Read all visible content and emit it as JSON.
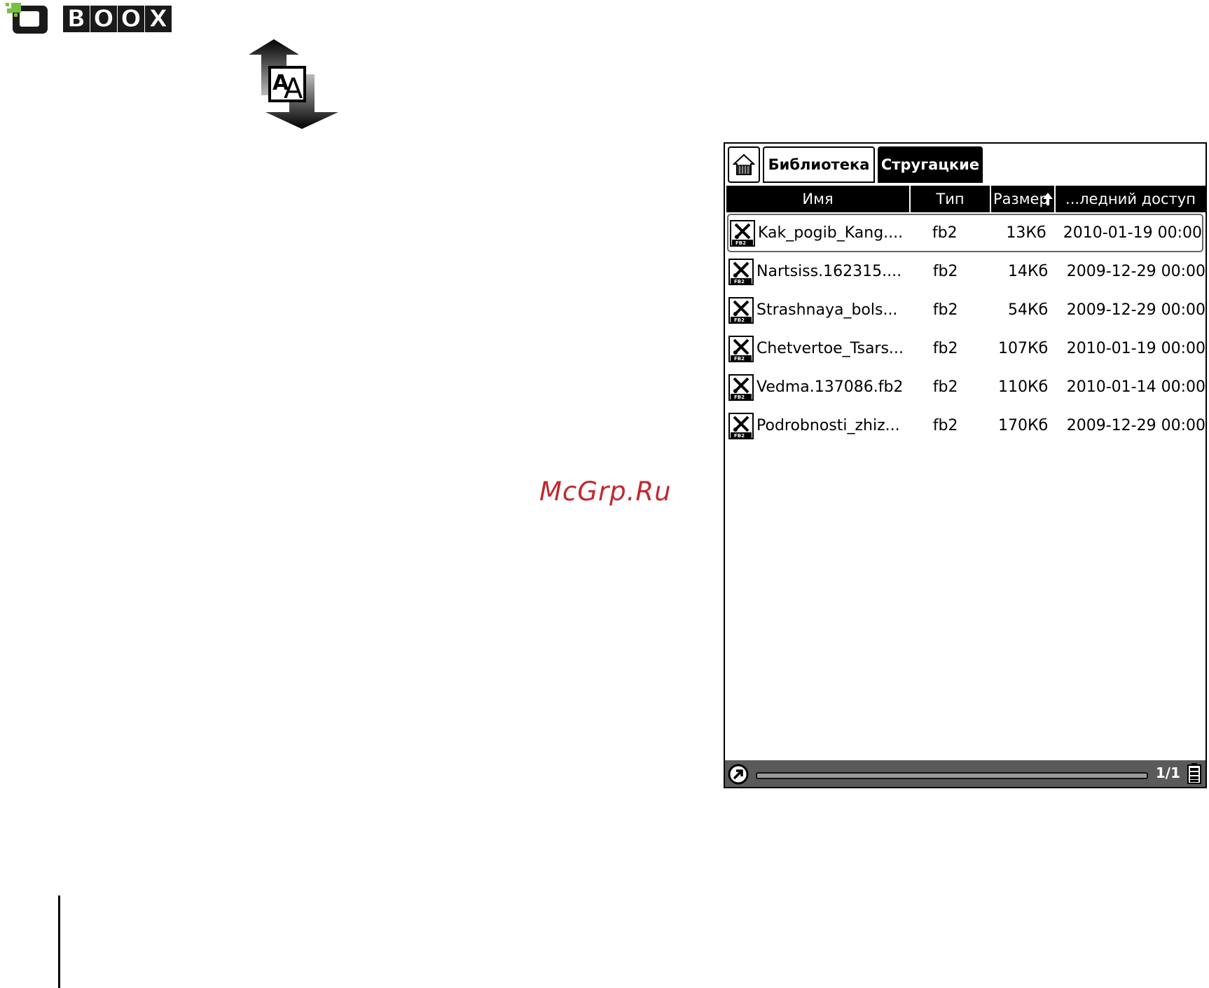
{
  "logo": {
    "letters": [
      "B",
      "O",
      "O",
      "X"
    ],
    "mark_color": "#78c043",
    "icon": "boox-logo-mark"
  },
  "font_size_icon": {
    "icon": "font-size-icon",
    "glyph": "AA"
  },
  "watermark": "McGrp.Ru",
  "screen": {
    "tabs": [
      {
        "label": "Библиотека"
      },
      {
        "label": "Стругацкие",
        "active": true
      }
    ],
    "home_icon": "home-icon",
    "columns": {
      "name": "Имя",
      "type": "Тип",
      "size": "Размер",
      "date": "...ледний доступ"
    },
    "sort_icon": "sort-arrow-icon",
    "files": [
      {
        "name": "Kak_pogib_Kang....",
        "type": "fb2",
        "size": "13Кб",
        "date": "2010-01-19 00:00",
        "selected": true
      },
      {
        "name": "Nartsiss.162315....",
        "type": "fb2",
        "size": "14Кб",
        "date": "2009-12-29 00:00"
      },
      {
        "name": "Strashnaya_bols...",
        "type": "fb2",
        "size": "54Кб",
        "date": "2009-12-29 00:00"
      },
      {
        "name": "Chetvertoe_Tsars...",
        "type": "fb2",
        "size": "107Кб",
        "date": "2010-01-19 00:00"
      },
      {
        "name": "Vedma.137086.fb2",
        "type": "fb2",
        "size": "110Кб",
        "date": "2010-01-14 00:00"
      },
      {
        "name": "Podrobnosti_zhiz...",
        "type": "fb2",
        "size": "170Кб",
        "date": "2009-12-29 00:00"
      }
    ],
    "file_icon": "fb2-file-icon",
    "status": {
      "page": "1/1",
      "menu_icon": "menu-arrow-icon",
      "battery_icon": "battery-icon"
    }
  },
  "colors": {
    "header_bg": "#000000",
    "status_bg": "#5a5a5a",
    "watermark": "#c0282e"
  }
}
